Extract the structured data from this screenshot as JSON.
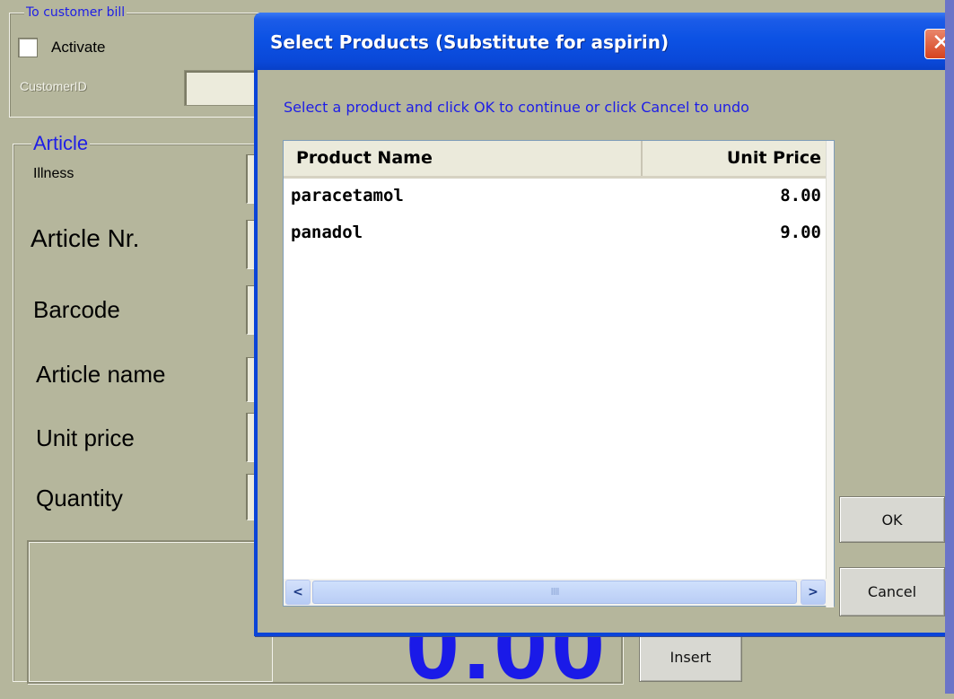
{
  "customer_bill": {
    "legend": "To customer bill",
    "activate_label": "Activate",
    "activate_checked": false,
    "customer_id_label": "CustomerID",
    "customer_id_value": ""
  },
  "article": {
    "legend": "Article",
    "fields": [
      {
        "label": "Illness",
        "value": ""
      },
      {
        "label": "Article Nr.",
        "value": ""
      },
      {
        "label": "Barcode",
        "value": ""
      },
      {
        "label": "Article name",
        "value": ""
      },
      {
        "label": "Unit price",
        "value": ""
      },
      {
        "label": "Quantity",
        "value": ""
      }
    ],
    "total_display": "0.00",
    "insert_label": "Insert"
  },
  "dialog": {
    "title": "Select Products (Substitute for aspirin)",
    "close_glyph": "✕",
    "instruction": "Select a product and click OK to continue or click Cancel to undo",
    "columns": {
      "name": "Product Name",
      "price": "Unit Price"
    },
    "rows": [
      {
        "name": "paracetamol",
        "price": "8.00"
      },
      {
        "name": "panadol",
        "price": "9.00"
      }
    ],
    "scroll_left_glyph": "<",
    "scroll_right_glyph": ">",
    "scroll_thumb_grip": "IIII",
    "ok_label": "OK",
    "cancel_label": "Cancel"
  },
  "colors": {
    "form_bg": "#b5b69c",
    "legend_text": "#1e1ee6",
    "title_bar": "#0a48d8",
    "total_display": "#1a1ae8"
  }
}
